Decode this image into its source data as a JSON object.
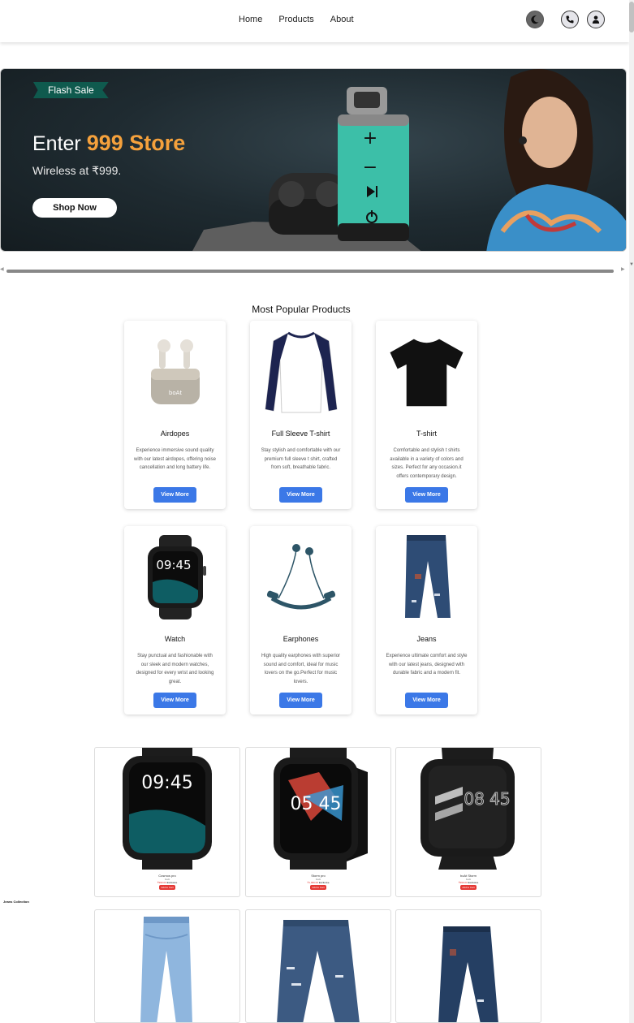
{
  "nav": {
    "links": [
      "Home",
      "Products",
      "About"
    ],
    "icons": [
      "moon-icon",
      "phone-icon",
      "user-icon"
    ]
  },
  "banner": {
    "tag": "Flash Sale",
    "title_prefix": "Enter",
    "title_highlight": "999 Store",
    "subtitle": "Wireless at ₹999.",
    "button": "Shop Now",
    "highlight_color": "#f5a13c",
    "tag_color": "#0f5a4e"
  },
  "popular": {
    "title": "Most Popular Products",
    "button_label": "View More",
    "button_color": "#3b78e7",
    "items": [
      {
        "name": "Airdopes",
        "desc": "Experience immersive sound quality with our latest airdopes, offering noise cancellation and long battery life.",
        "icon": "earbuds-icon"
      },
      {
        "name": "Full Sleeve T-shirt",
        "desc": "Stay stylish and comfortable with our premium full sleeve t shirt, crafted from soft, breathable fabric.",
        "icon": "full-sleeve-shirt-icon"
      },
      {
        "name": "T-shirt",
        "desc": "Comfortable and stylish t shirts available in a variety of colors and sizes. Perfect for any occasion.it offers contemporary design.",
        "icon": "tshirt-icon"
      },
      {
        "name": "Watch",
        "desc": "Stay punctual and fashionable with our sleek and modern watches, designed for every wrist and looking great.",
        "icon": "watch-icon"
      },
      {
        "name": "Earphones",
        "desc": "High quality earphones with superior sound and comfort, ideal for music lovers on the go.Perfect for music lovers.",
        "icon": "neckband-earphones-icon"
      },
      {
        "name": "Jeans",
        "desc": "Experience ultimate comfort and style with our latest jeans, designed with durable fabric and a modern fit.",
        "icon": "jeans-icon"
      }
    ]
  },
  "watch_store": [
    {
      "name": "Cosmos pro",
      "brand": "boAt",
      "price": "₹999.00",
      "tag": "Exclusive",
      "button": "Add to Cart",
      "screen_text": "09:45"
    },
    {
      "name": "Storm pro",
      "brand": "boAt",
      "price": "₹1,999.00",
      "tag": "Exclusive",
      "button": "Add to Cart",
      "screen_text": "05 45"
    },
    {
      "name": "boAt Storm",
      "brand": "boAt",
      "price": "₹999.00",
      "tag": "Exclusive",
      "button": "Add to Cart",
      "screen_text": "08 45"
    }
  ],
  "jeans_collection": {
    "label": "Jeans Collection",
    "items": [
      "light-blue-jeans-icon",
      "ripped-jeans-icon",
      "dark-ripped-jeans-icon"
    ]
  }
}
